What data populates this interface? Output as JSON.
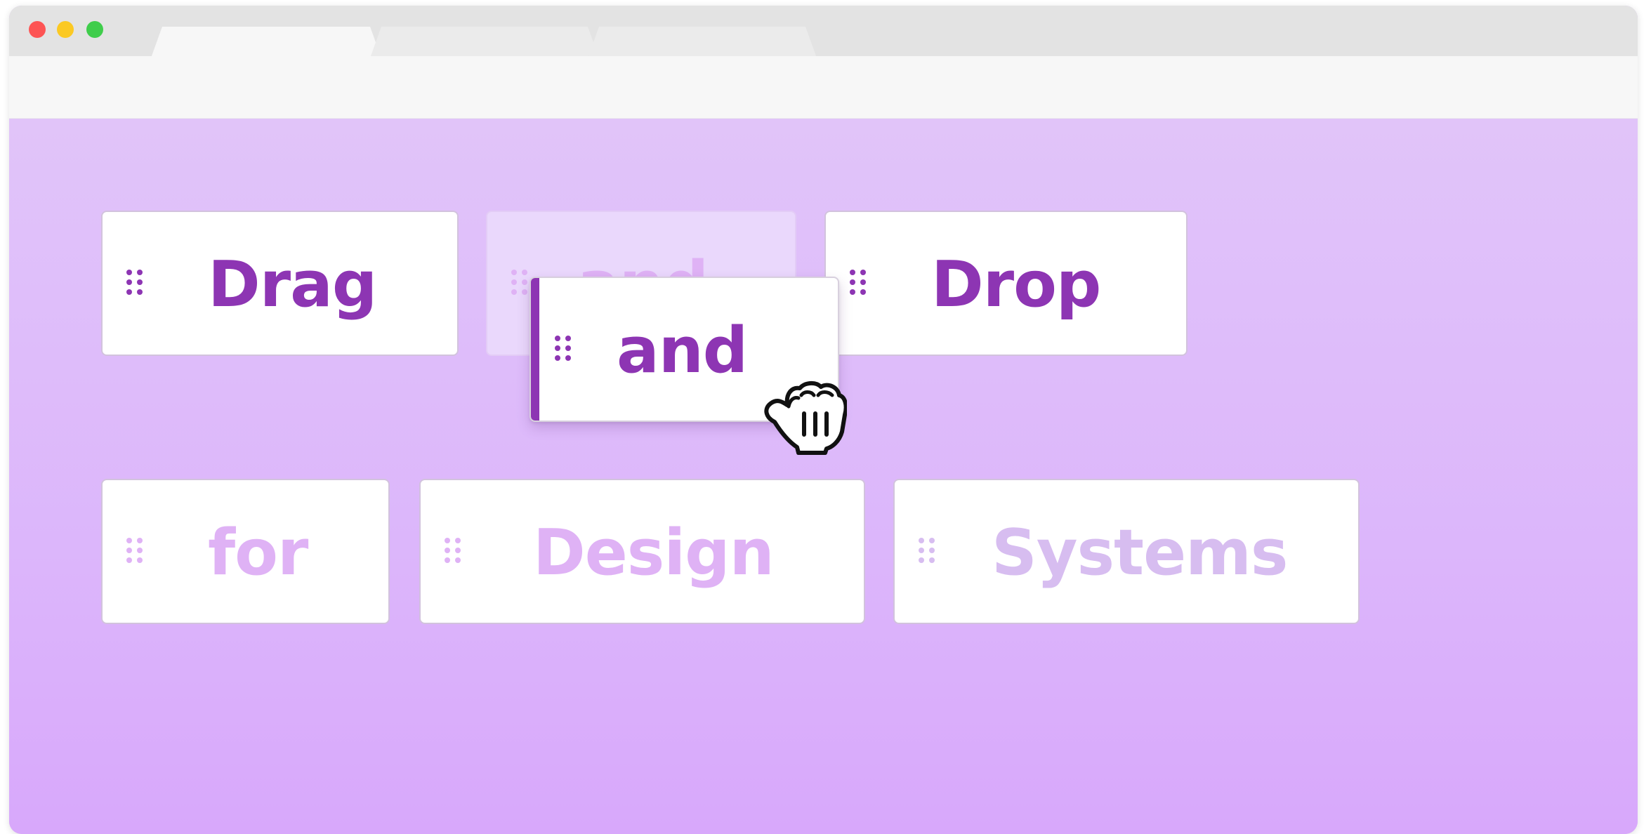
{
  "window": {
    "controls": [
      "close",
      "minimize",
      "zoom"
    ],
    "tab_count": 3
  },
  "cards": {
    "row1": {
      "drag": {
        "label": "Drag",
        "icon": "drag-handle-icon"
      },
      "and_placeholder": {
        "label": "and",
        "icon": "drag-handle-icon"
      },
      "drop": {
        "label": "Drop",
        "icon": "drag-handle-icon"
      }
    },
    "row2": {
      "for": {
        "label": "for",
        "icon": "drag-handle-icon"
      },
      "design": {
        "label": "Design",
        "icon": "drag-handle-icon"
      },
      "systems": {
        "label": "Systems",
        "icon": "drag-handle-icon"
      }
    },
    "dragging": {
      "label": "and",
      "icon": "drag-handle-icon"
    }
  },
  "cursor": {
    "icon": "grab-hand-cursor-icon"
  },
  "colors": {
    "accent": "#8d35b3",
    "muted_text": "#dfb2f5",
    "background_top": "#e1c4f9",
    "background_bottom": "#d8a8fb"
  }
}
